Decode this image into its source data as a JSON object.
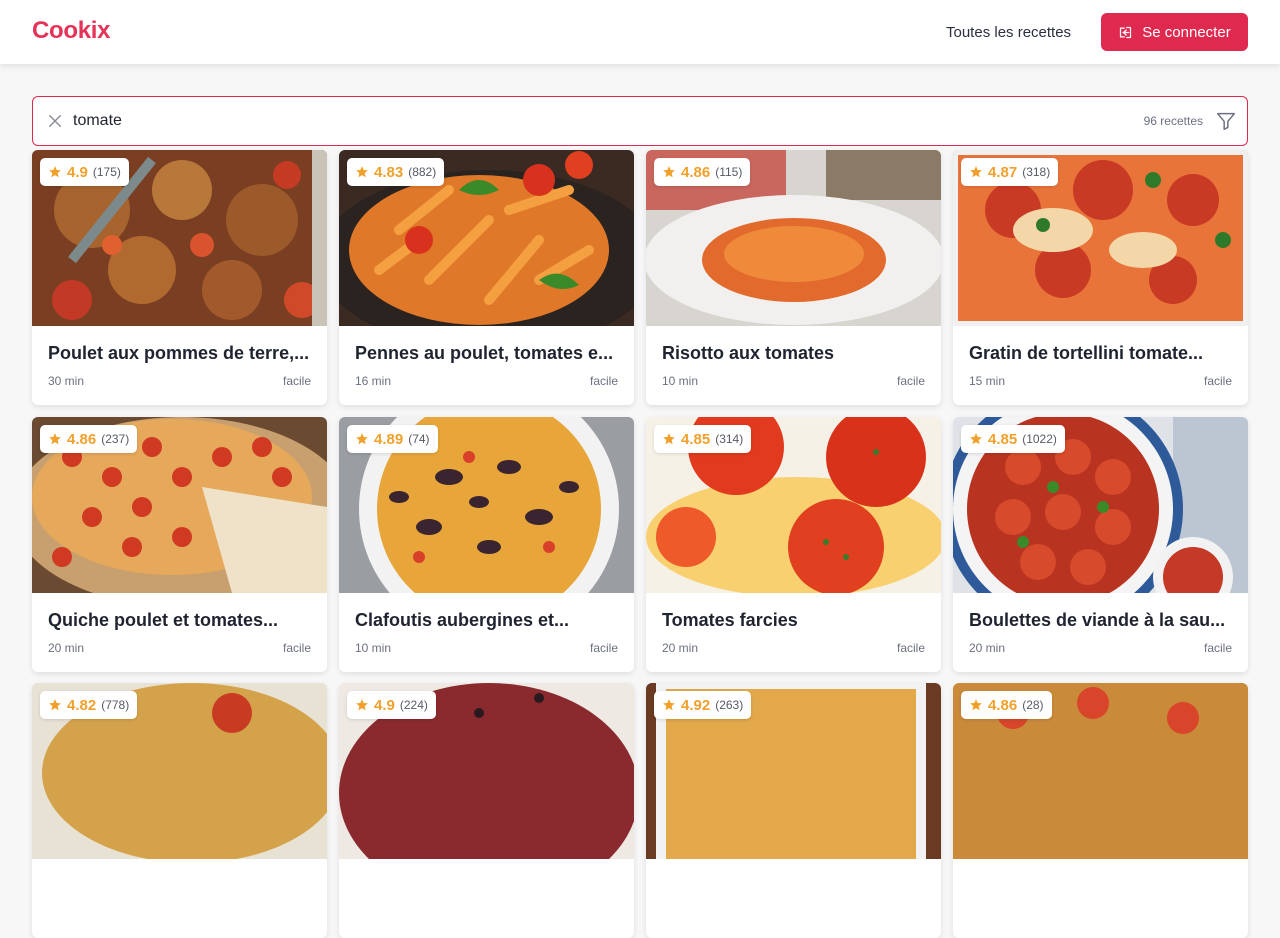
{
  "header": {
    "logo": "Cookix",
    "nav_all": "Toutes les recettes",
    "login_label": "Se connecter"
  },
  "search": {
    "value": "tomate",
    "count_label": "96 recettes"
  },
  "colors": {
    "brand": "#e0294f",
    "star": "#f0a02b"
  },
  "recipes": [
    {
      "title": "Poulet aux pommes de terre,...",
      "rating": "4.9",
      "votes": "(175)",
      "time": "30 min",
      "difficulty": "facile"
    },
    {
      "title": "Pennes au poulet, tomates e...",
      "rating": "4.83",
      "votes": "(882)",
      "time": "16 min",
      "difficulty": "facile"
    },
    {
      "title": "Risotto aux tomates",
      "rating": "4.86",
      "votes": "(115)",
      "time": "10 min",
      "difficulty": "facile"
    },
    {
      "title": "Gratin de tortellini tomate...",
      "rating": "4.87",
      "votes": "(318)",
      "time": "15 min",
      "difficulty": "facile"
    },
    {
      "title": "Quiche poulet et tomates...",
      "rating": "4.86",
      "votes": "(237)",
      "time": "20 min",
      "difficulty": "facile"
    },
    {
      "title": "Clafoutis aubergines et...",
      "rating": "4.89",
      "votes": "(74)",
      "time": "10 min",
      "difficulty": "facile"
    },
    {
      "title": "Tomates farcies",
      "rating": "4.85",
      "votes": "(314)",
      "time": "20 min",
      "difficulty": "facile"
    },
    {
      "title": "Boulettes de viande à la sau...",
      "rating": "4.85",
      "votes": "(1022)",
      "time": "20 min",
      "difficulty": "facile"
    },
    {
      "title": "",
      "rating": "4.82",
      "votes": "(778)",
      "time": "",
      "difficulty": ""
    },
    {
      "title": "",
      "rating": "4.9",
      "votes": "(224)",
      "time": "",
      "difficulty": ""
    },
    {
      "title": "",
      "rating": "4.92",
      "votes": "(263)",
      "time": "",
      "difficulty": ""
    },
    {
      "title": "",
      "rating": "4.86",
      "votes": "(28)",
      "time": "",
      "difficulty": ""
    }
  ]
}
